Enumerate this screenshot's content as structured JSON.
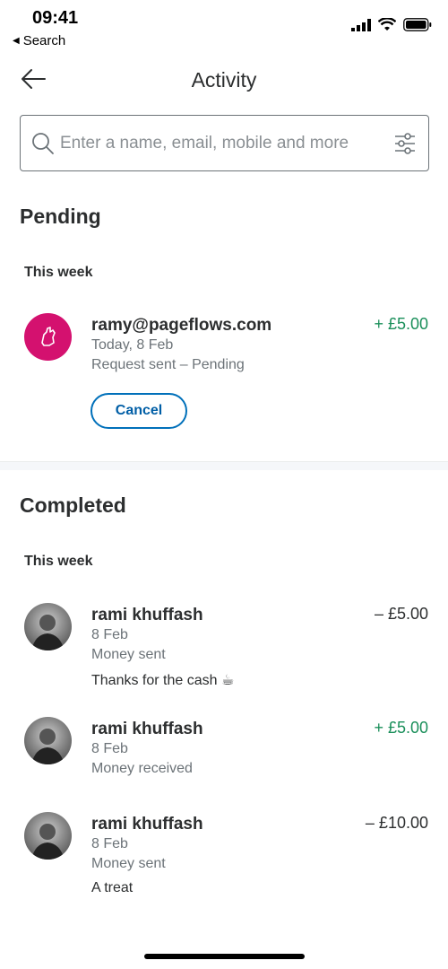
{
  "status_bar": {
    "time": "09:41",
    "back_label": "Search",
    "back_glyph": "◀"
  },
  "header": {
    "title": "Activity",
    "back_icon": "arrow-left-icon"
  },
  "search": {
    "placeholder": "Enter a name, email, mobile and more",
    "value": ""
  },
  "pending": {
    "title": "Pending",
    "group_label": "This week",
    "transaction": {
      "name": "ramy@pageflows.com",
      "date": "Today, 8 Feb",
      "status": "Request sent – Pending",
      "amount": "+ £5.00",
      "cancel_label": "Cancel"
    }
  },
  "completed": {
    "title": "Completed",
    "group_label": "This week",
    "transactions": [
      {
        "name": "rami khuffash",
        "date": "8 Feb",
        "type": "Money sent",
        "note": "Thanks for the cash ☕",
        "amount": "– £5.00"
      },
      {
        "name": "rami khuffash",
        "date": "8 Feb",
        "type": "Money received",
        "note": "",
        "amount": "+ £5.00"
      },
      {
        "name": "rami khuffash",
        "date": "8 Feb",
        "type": "Money sent",
        "note": "A treat",
        "amount": "– £10.00"
      }
    ]
  },
  "colors": {
    "positive": "#1a8f5a",
    "accent": "#0070ba",
    "pending_avatar": "#d4116f"
  }
}
